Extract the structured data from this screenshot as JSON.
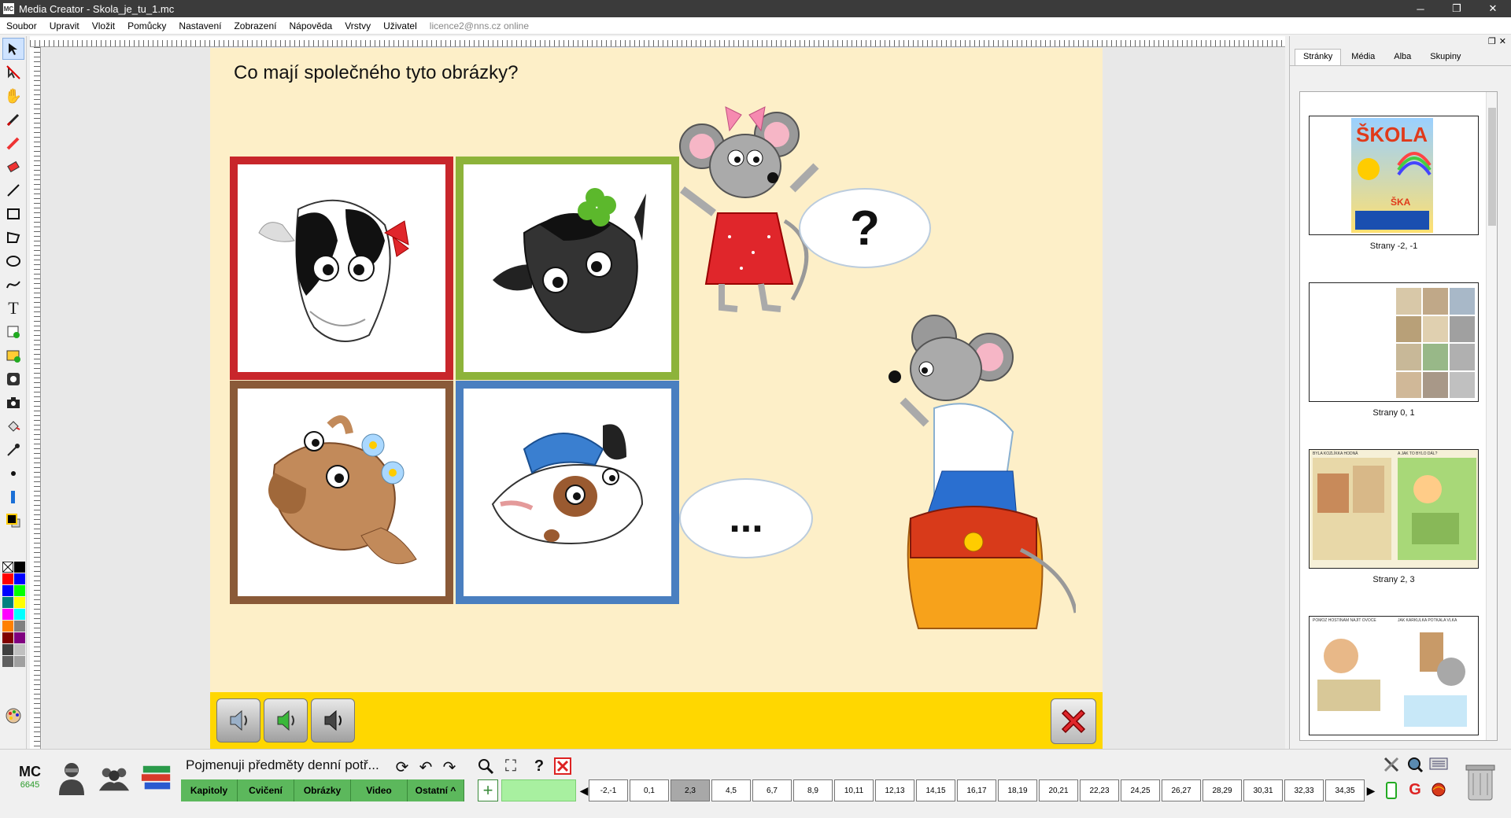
{
  "window": {
    "title": "Media Creator - Skola_je_tu_1.mc",
    "app_icon": "MC",
    "minimize": "─",
    "maximize": "❐",
    "close": "✕"
  },
  "menu": {
    "items": [
      "Soubor",
      "Upravit",
      "Vložit",
      "Pomůcky",
      "Nastavení",
      "Zobrazení",
      "Nápověda",
      "Vrstvy",
      "Uživatel"
    ],
    "status": "licence2@nns.cz online"
  },
  "page": {
    "question": "Co mají společného tyto obrázky?",
    "bubble_top": "?",
    "bubble_bottom": "...",
    "frame_colors": [
      "#c8262b",
      "#8db33a",
      "#8a5a38",
      "#4a7fc0"
    ],
    "background": "#fdefc8",
    "strip_color": "#ffd700"
  },
  "right_panel": {
    "tabs": [
      "Stránky",
      "Média",
      "Alba",
      "Skupiny"
    ],
    "active_tab": "Stránky",
    "thumbs": [
      {
        "caption": "Strany -2, -1",
        "title_text": "ŠKOLA",
        "subtitle": "ŠKA"
      },
      {
        "caption": "Strany 0, 1"
      },
      {
        "caption": "Strany 2, 3",
        "left_heading": "BYLA KOZLÍKKA HODNÁ",
        "right_heading": "A JAK TO BYLO DÁL?"
      },
      {
        "caption": "",
        "left_heading": "POMOZ HOSTINAM NAJÍT OVOCE",
        "right_heading": "JAK KARKULKA POTKALA VLKA"
      }
    ]
  },
  "bottom": {
    "mc_label": "MC",
    "mc_number": "6645",
    "lesson_title": "Pojmenuji předměty denní potř...",
    "tabs": [
      "Kapitoly",
      "Cvičení",
      "Obrázky",
      "Video",
      "Ostatní ^"
    ],
    "add": "+",
    "pages": [
      "-2,-1",
      "0,1",
      "2,3",
      "4,5",
      "6,7",
      "8,9",
      "10,11",
      "12,13",
      "14,15",
      "16,17",
      "18,19",
      "20,21",
      "22,23",
      "24,25",
      "26,27",
      "28,29",
      "30,31",
      "32,33",
      "34,35"
    ],
    "active_page": "2,3",
    "prev": "◀",
    "next": "▶",
    "help": "?"
  },
  "colors": {
    "palette": [
      "#ffffff",
      "#000000",
      "#ff0000",
      "#0000ff",
      "#0000ff",
      "#00ff00",
      "#008080",
      "#ffff00",
      "#ff00ff",
      "#00ffff",
      "#ff8000",
      "#808080",
      "#800000",
      "#800080",
      "#404040",
      "#c0c0c0",
      "#606060",
      "#a0a0a0"
    ]
  }
}
